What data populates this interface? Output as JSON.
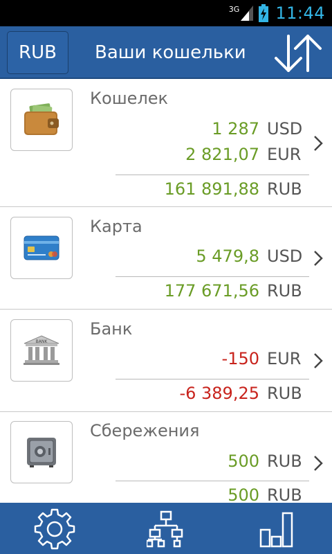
{
  "status_bar": {
    "network": "3G",
    "time": "11:44"
  },
  "header": {
    "currency_button": "RUB",
    "title": "Ваши кошельки"
  },
  "wallets": [
    {
      "name": "Кошелек",
      "icon": "wallet-icon",
      "balances": [
        {
          "amount": "1 287",
          "currency": "USD",
          "sign": "positive"
        },
        {
          "amount": "2 821,07",
          "currency": "EUR",
          "sign": "positive"
        }
      ],
      "total": {
        "amount": "161 891,88",
        "currency": "RUB",
        "sign": "positive"
      }
    },
    {
      "name": "Карта",
      "icon": "credit-card-icon",
      "balances": [
        {
          "amount": "5 479,8",
          "currency": "USD",
          "sign": "positive"
        }
      ],
      "total": {
        "amount": "177 671,56",
        "currency": "RUB",
        "sign": "positive"
      }
    },
    {
      "name": "Банк",
      "icon": "bank-building-icon",
      "icon_label": "BANK",
      "balances": [
        {
          "amount": "-150",
          "currency": "EUR",
          "sign": "negative"
        }
      ],
      "total": {
        "amount": "-6 389,25",
        "currency": "RUB",
        "sign": "negative"
      }
    },
    {
      "name": "Сбережения",
      "icon": "safe-icon",
      "balances": [
        {
          "amount": "500",
          "currency": "RUB",
          "sign": "positive"
        }
      ],
      "total": {
        "amount": "500",
        "currency": "RUB",
        "sign": "positive"
      }
    }
  ],
  "bottom_bar": {
    "items": [
      "settings-gear-icon",
      "hierarchy-icon",
      "bar-chart-icon"
    ]
  },
  "colors": {
    "header": "#2a5fa0",
    "positive": "#6a9c26",
    "negative": "#c8231c",
    "status_accent": "#33b5e5"
  }
}
